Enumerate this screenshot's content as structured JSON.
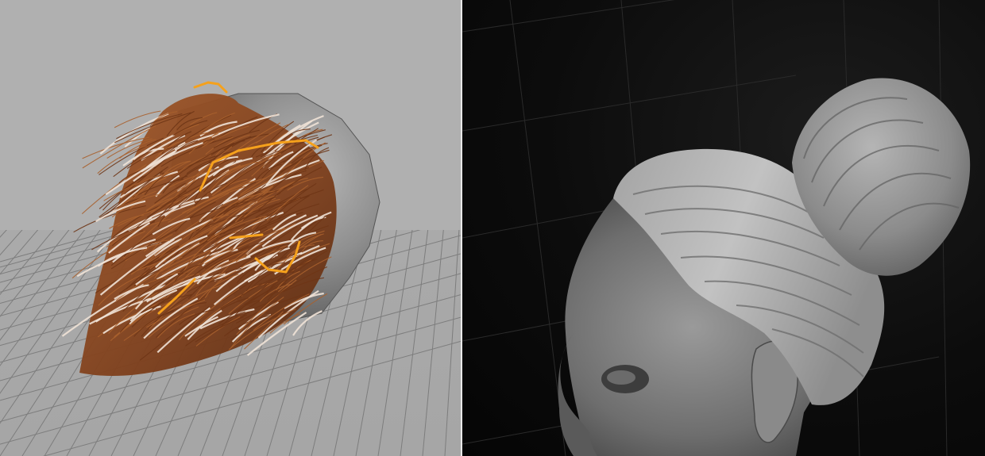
{
  "colors": {
    "left_background": "#b0b0b0",
    "grid_line": "#7f7f7f",
    "scalp_grey": "#8c8c8c",
    "hair_brown": "#8a4a22",
    "hair_highlight": "#f0e2d6",
    "guide_curve_orange": "#f5a11c",
    "right_background": "#0e0e0e",
    "sculpt_grey": "#9a9a9a"
  },
  "scenes": {
    "left": {
      "description_icon": "hair-groom-viewport-icon"
    },
    "right": {
      "description_icon": "sculpted-bun-hair-icon"
    }
  }
}
